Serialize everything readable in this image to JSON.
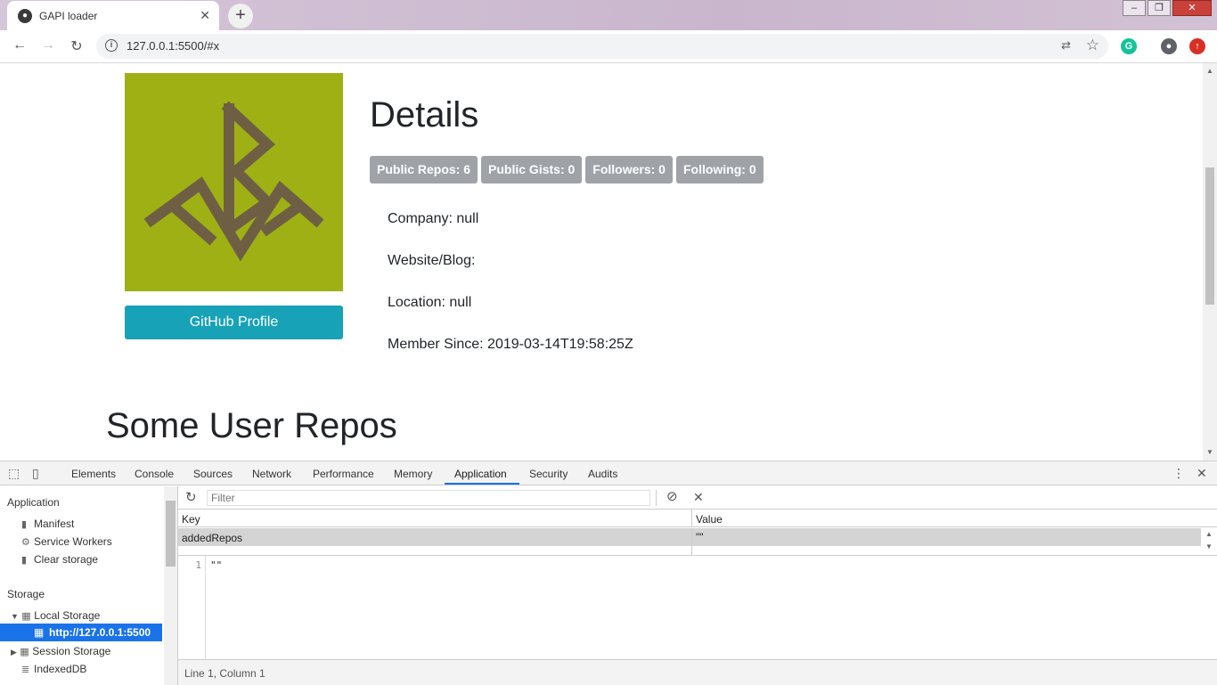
{
  "browser": {
    "tab_title": "GAPI loader",
    "tab_close": "✕",
    "new_tab": "+",
    "url": "127.0.0.1:5500/#x",
    "window_controls": {
      "minimize": "–",
      "maximize": "❐",
      "close": "✕"
    }
  },
  "page": {
    "profile_button": "GitHub Profile",
    "details_title": "Details",
    "badges": {
      "repos": "Public Repos: 6",
      "gists": "Public Gists: 0",
      "followers": "Followers: 0",
      "following": "Following: 0"
    },
    "company": "Company: null",
    "website": "Website/Blog:",
    "location": "Location: null",
    "member_since": "Member Since: 2019-03-14T19:58:25Z",
    "repos_title": "Some User Repos",
    "colors": {
      "avatar_bg": "#9fb014",
      "button": "#17a2b8",
      "badge": "#9fa3a8"
    }
  },
  "devtools": {
    "tabs": [
      "Elements",
      "Console",
      "Sources",
      "Network",
      "Performance",
      "Memory",
      "Application",
      "Security",
      "Audits"
    ],
    "active_tab": "Application",
    "sidebar": {
      "application_header": "Application",
      "manifest": "Manifest",
      "service_workers": "Service Workers",
      "clear_storage": "Clear storage",
      "storage_header": "Storage",
      "local_storage": "Local Storage",
      "local_origin": "http://127.0.0.1:5500",
      "session_storage": "Session Storage",
      "indexeddb": "IndexedDB"
    },
    "filter_placeholder": "Filter",
    "table": {
      "key_header": "Key",
      "value_header": "Value",
      "row_key": "addedRepos",
      "row_value": "\"\""
    },
    "editor": {
      "line_number": "1",
      "content": "\"\""
    },
    "status": "Line 1, Column 1"
  }
}
